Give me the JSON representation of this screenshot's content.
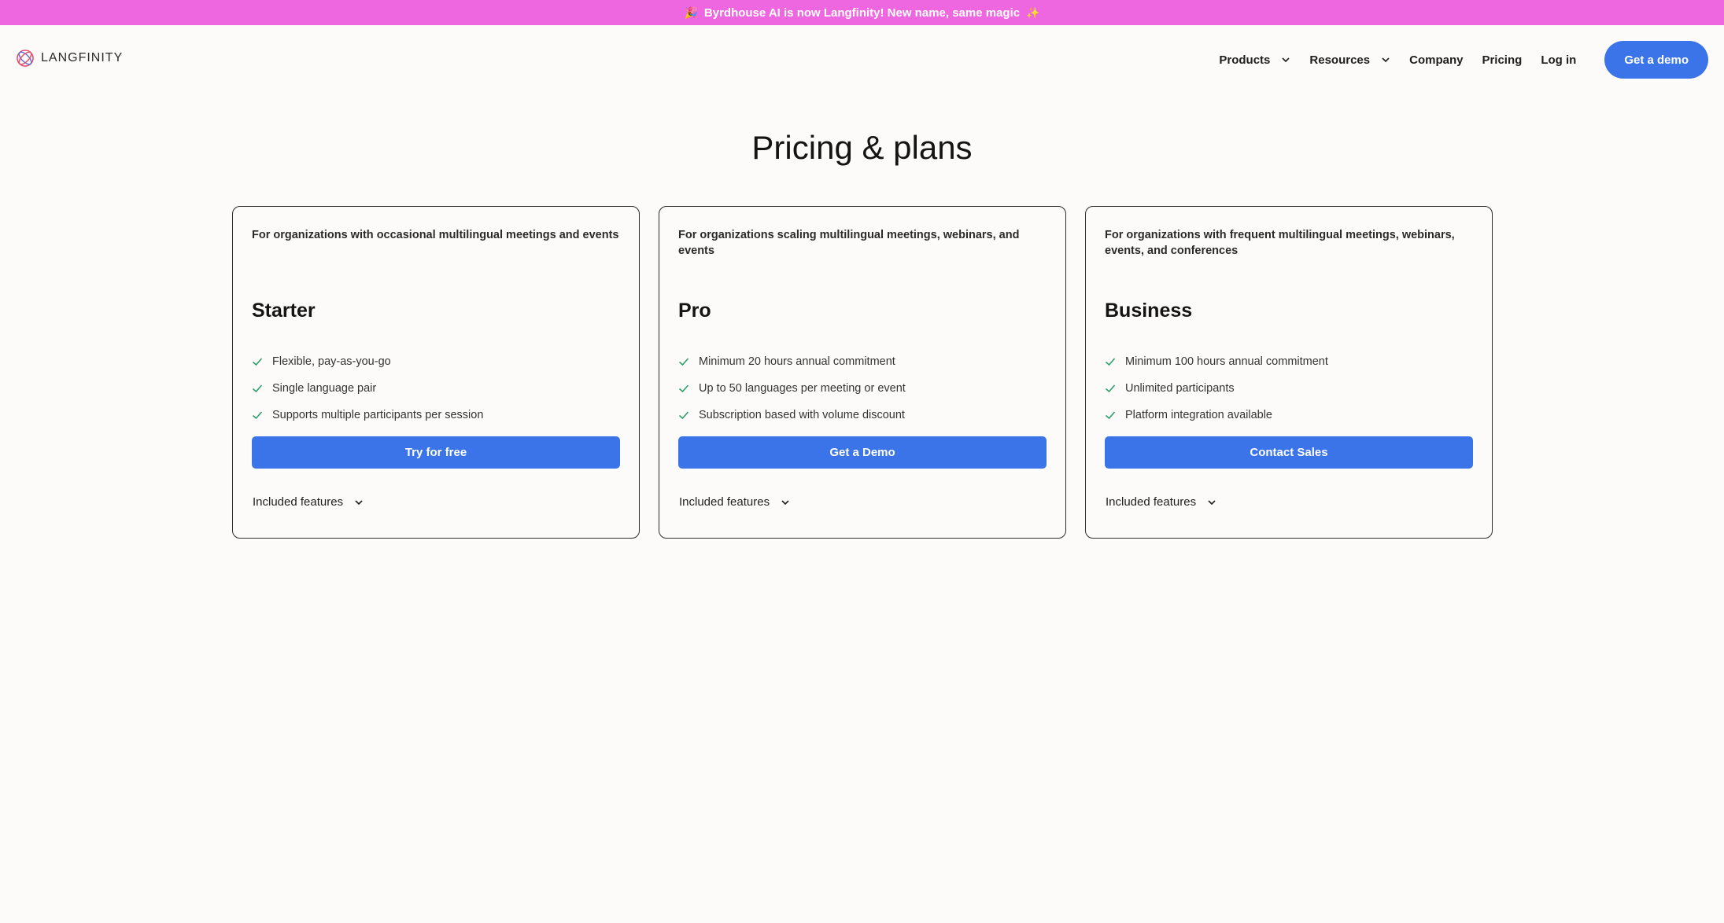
{
  "banner": {
    "emoji_left": "🎉",
    "text": "Byrdhouse AI is now Langfinity! New name, same magic",
    "emoji_right": "✨"
  },
  "brand": {
    "logo_text": "LANGFINITY",
    "logo_icon": "infinity-globe-icon"
  },
  "nav": {
    "products": "Products",
    "resources": "Resources",
    "company": "Company",
    "pricing": "Pricing",
    "login": "Log in",
    "demo": "Get a demo"
  },
  "page": {
    "title": "Pricing & plans"
  },
  "plans": [
    {
      "desc": "For organizations with occasional multilingual meetings and events",
      "name": "Starter",
      "features": [
        "Flexible, pay-as-you-go",
        "Single language pair",
        "Supports multiple participants per session"
      ],
      "cta": "Try for free",
      "included": "Included features"
    },
    {
      "desc": "For organizations scaling multilingual meetings, webinars, and events",
      "name": "Pro",
      "features": [
        "Minimum 20 hours annual commitment",
        "Up to 50 languages per meeting or event",
        "Subscription based with volume discount"
      ],
      "cta": "Get a Demo",
      "included": "Included features"
    },
    {
      "desc": "For organizations with frequent multilingual meetings, webinars, events, and conferences",
      "name": "Business",
      "features": [
        "Minimum 100 hours annual commitment",
        "Unlimited participants",
        "Platform integration available"
      ],
      "cta": "Contact Sales",
      "included": "Included features"
    }
  ],
  "colors": {
    "banner": "#ee66e0",
    "accent": "#3b74e8",
    "check": "#2e9e6b",
    "background": "#fdfbf9"
  }
}
